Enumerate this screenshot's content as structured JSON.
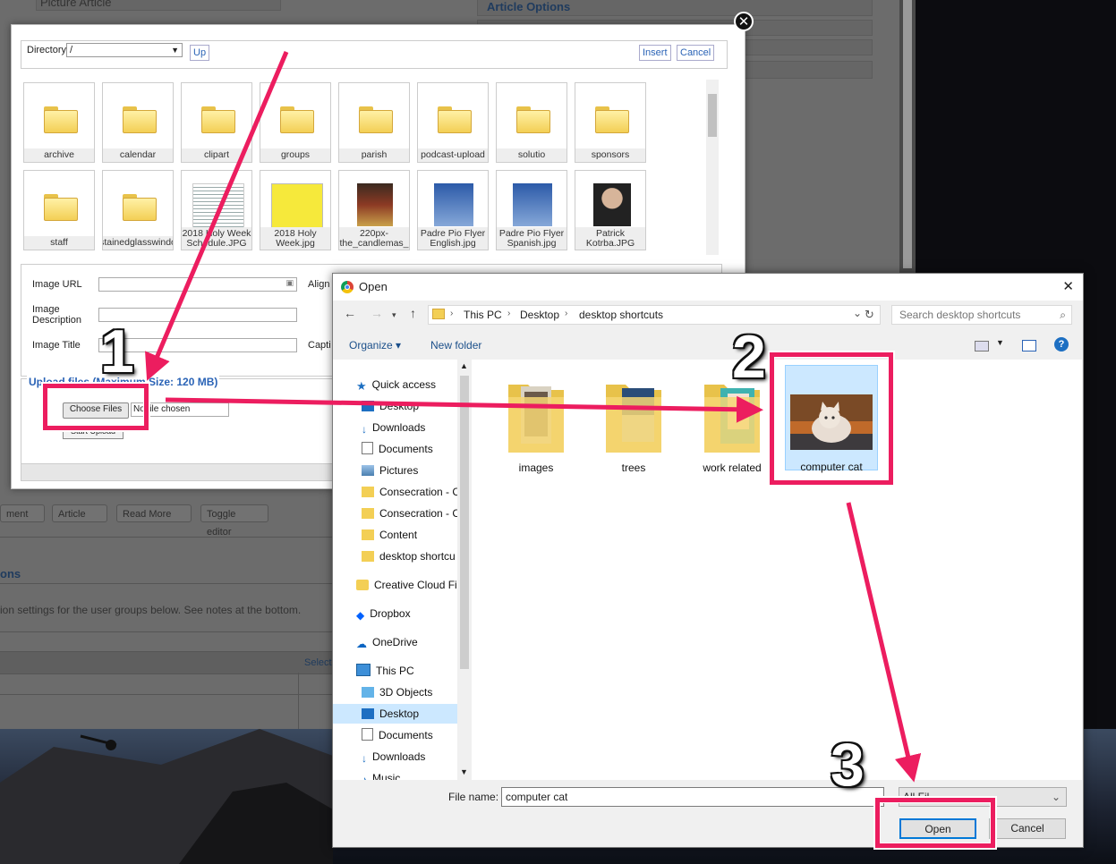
{
  "background": {
    "picture_article": "Picture Article",
    "article_options": "Article Options",
    "buttons": [
      "ment",
      "Article",
      "Read More",
      "Toggle editor"
    ],
    "section_heading": "ons",
    "permission_text": "ion settings for the user groups below. See notes at the bottom.",
    "select_label": "Select"
  },
  "image_manager": {
    "directory_label": "Directory",
    "directory_value": "/",
    "up_label": "Up",
    "insert_label": "Insert",
    "cancel_label": "Cancel",
    "close_glyph": "✕",
    "tiles": [
      {
        "label": "archive",
        "kind": "folder"
      },
      {
        "label": "calendar",
        "kind": "folder"
      },
      {
        "label": "clipart",
        "kind": "folder"
      },
      {
        "label": "groups",
        "kind": "folder"
      },
      {
        "label": "parish",
        "kind": "folder"
      },
      {
        "label": "podcast-upload",
        "kind": "folder"
      },
      {
        "label": "solutio",
        "kind": "folder"
      },
      {
        "label": "sponsors",
        "kind": "folder"
      },
      {
        "label": "staff",
        "kind": "folder"
      },
      {
        "label": "stainedglasswindo",
        "kind": "folder"
      },
      {
        "label": "2018 Holy Week Schedule.JPG",
        "kind": "image",
        "line1": "2018 Holy Week",
        "line2": "Schedule.JPG"
      },
      {
        "label": "2018 Holy Week.jpg",
        "kind": "image",
        "line1": "2018 Holy",
        "line2": "Week.jpg"
      },
      {
        "label": "220px-the_candlemas_",
        "kind": "image",
        "line1": "220px-",
        "line2": "the_candlemas_"
      },
      {
        "label": "Padre Pio Flyer English.jpg",
        "kind": "image",
        "line1": "Padre Pio Flyer",
        "line2": "English.jpg"
      },
      {
        "label": "Padre Pio Flyer Spanish.jpg",
        "kind": "image",
        "line1": "Padre Pio Flyer",
        "line2": "Spanish.jpg"
      },
      {
        "label": "Patrick Kotrba.JPG",
        "kind": "image",
        "line1": "Patrick",
        "line2": "Kotrba.JPG"
      }
    ],
    "form": {
      "image_url_label": "Image URL",
      "image_description_label": "Image Description",
      "image_title_label": "Image Title",
      "align_label": "Align",
      "caption_label": "Capti"
    },
    "upload": {
      "title": "Upload files (Maximum Size: 120 MB)",
      "choose_files_label": "Choose Files",
      "no_file_label": "No file chosen",
      "start_upload_label": "Start Upload"
    }
  },
  "open_dialog": {
    "title": "Open",
    "close_glyph": "✕",
    "breadcrumb": [
      "This PC",
      "Desktop",
      "desktop shortcuts"
    ],
    "search_placeholder": "Search desktop shortcuts",
    "organize_label": "Organize ▾",
    "new_folder_label": "New folder",
    "sidebar": [
      {
        "label": "Quick access",
        "icon": "star-icon",
        "indent": 0
      },
      {
        "label": "Desktop",
        "icon": "desktop-icon",
        "indent": 1,
        "pin": true
      },
      {
        "label": "Downloads",
        "icon": "download-icon",
        "indent": 1,
        "pin": true
      },
      {
        "label": "Documents",
        "icon": "document-icon",
        "indent": 1,
        "pin": true
      },
      {
        "label": "Pictures",
        "icon": "pictures-icon",
        "indent": 1,
        "pin": true
      },
      {
        "label": "Consecration - C",
        "icon": "folder-icon",
        "indent": 1
      },
      {
        "label": "Consecration - C",
        "icon": "folder-icon",
        "indent": 1
      },
      {
        "label": "Content",
        "icon": "folder-icon",
        "indent": 1
      },
      {
        "label": "desktop shortcu",
        "icon": "folder-icon",
        "indent": 1
      },
      {
        "label": "Creative Cloud Fil",
        "icon": "creative-cloud-icon",
        "indent": 0
      },
      {
        "label": "Dropbox",
        "icon": "dropbox-icon",
        "indent": 0
      },
      {
        "label": "OneDrive",
        "icon": "onedrive-icon",
        "indent": 0
      },
      {
        "label": "This PC",
        "icon": "computer-icon",
        "indent": 0
      },
      {
        "label": "3D Objects",
        "icon": "cube-icon",
        "indent": 1
      },
      {
        "label": "Desktop",
        "icon": "desktop-icon",
        "indent": 1,
        "selected": true
      },
      {
        "label": "Documents",
        "icon": "document-icon",
        "indent": 1
      },
      {
        "label": "Downloads",
        "icon": "download-icon",
        "indent": 1
      },
      {
        "label": "Music",
        "icon": "music-icon",
        "indent": 1
      }
    ],
    "files": [
      {
        "label": "images",
        "kind": "folder"
      },
      {
        "label": "trees",
        "kind": "folder"
      },
      {
        "label": "work related",
        "kind": "folder"
      },
      {
        "label": "computer cat",
        "kind": "image",
        "selected": true
      }
    ],
    "file_name_label": "File name:",
    "file_name_value": "computer cat",
    "file_type_value": "All Fil",
    "open_label": "Open",
    "cancel_label": "Cancel"
  },
  "annotations": {
    "step1": "1",
    "step2": "2",
    "step3": "3",
    "color": "#ec1d5f"
  }
}
